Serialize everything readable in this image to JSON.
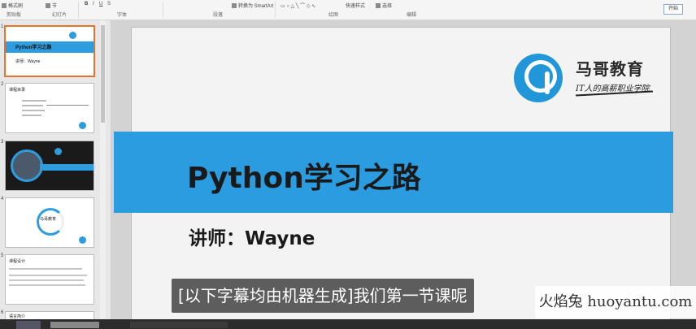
{
  "ribbon": {
    "groups": [
      "剪贴板",
      "幻灯片",
      "字体",
      "段落",
      "绘图",
      "编辑"
    ],
    "items": [
      "格式刷",
      "节",
      "转换为 SmartArt",
      "快速样式",
      "选择"
    ],
    "open_button": "开始"
  },
  "thumbnails": [
    {
      "number": "1",
      "title": "Python学习之路",
      "sub": "讲师：Wayne"
    },
    {
      "number": "2",
      "title": "课程目录"
    },
    {
      "number": "3",
      "title": ""
    },
    {
      "number": "4",
      "title": "马哥教育"
    },
    {
      "number": "5",
      "title": "课程设计"
    },
    {
      "number": "6",
      "title": "语言简介"
    }
  ],
  "slide": {
    "logo_name": "马哥教育",
    "logo_tagline": "IT人的高薪职业学院",
    "title": "Python学习之路",
    "presenter": "讲师：Wayne"
  },
  "caption": "[以下字幕均由机器生成]我们第一节课呢",
  "watermark": "火焰兔 huoyantu.com",
  "colors": {
    "accent": "#2b9ce0",
    "active_thumb_border": "#e3732f"
  }
}
